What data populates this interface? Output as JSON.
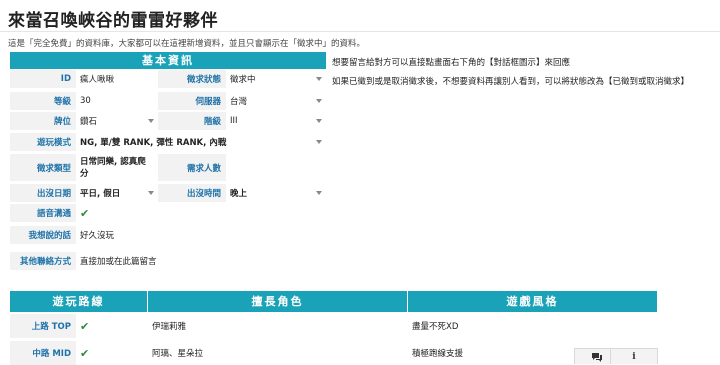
{
  "page": {
    "title": "來當召喚峽谷的雷雷好夥伴",
    "notice": "這是「完全免費」的資料庫，大家都可以在這裡新增資料，並且只會顯示在「徵求中」的資料。"
  },
  "basic": {
    "header": "基本資訊",
    "id_label": "ID",
    "id_value": "瘋人啾啾",
    "status_label": "徵求狀態",
    "status_value": "徵求中",
    "level_label": "等級",
    "level_value": "30",
    "server_label": "伺服器",
    "server_value": "台灣",
    "rank_label": "牌位",
    "rank_value": "鑽石",
    "tier_label": "階級",
    "tier_value": "III",
    "mode_label": "遊玩模式",
    "mode_value": "NG, 單/雙 RANK, 彈性 RANK, 內戰",
    "type_label": "徵求類型",
    "type_value_1": "日常同樂, 認真爬",
    "type_value_2": "分",
    "need_label": "需求人數",
    "need_value": "",
    "day_label": "出沒日期",
    "day_value": "平日, 假日",
    "time_label": "出沒時間",
    "time_value": "晚上",
    "voice_label": "語音溝通",
    "say_label": "我想說的話",
    "say_value": "好久沒玩",
    "contact_label": "其他聯絡方式",
    "contact_value": "直接加或在此篇留言"
  },
  "side_notes": {
    "line1": "想要留言給對方可以直接點畫面右下角的【對話框圖示】來回應",
    "line2": "如果已徵到或是取消徵求後，不想要資料再讓別人看到，可以將狀態改為【已徵到或取消徵求】"
  },
  "lanes": {
    "col1": "遊玩路線",
    "col2": "擅長角色",
    "col3": "遊戲風格",
    "rows": [
      {
        "lane": "上路 TOP",
        "champ": "伊瑞莉雅",
        "style": "盡量不死XD"
      },
      {
        "lane": "中路 MID",
        "champ": "阿璃、星朵拉",
        "style": "積極跑線支援"
      }
    ]
  },
  "icons": {
    "chat": "chat-bubbles-icon",
    "info": "info-icon",
    "check": "check-icon",
    "caret": "caret-down-icon"
  },
  "colors": {
    "accent": "#1aa3b8",
    "label": "#1e72a8",
    "check": "#2e8b3a"
  }
}
